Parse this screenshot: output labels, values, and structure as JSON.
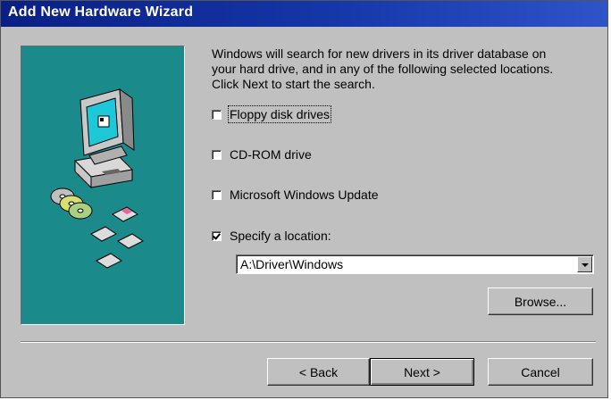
{
  "window": {
    "title": "Add New Hardware Wizard"
  },
  "intro_lines": [
    "Windows will search for new drivers in its driver database on",
    "your hard drive, and in any of the following selected locations.",
    "Click Next to start the search."
  ],
  "options": [
    {
      "label": "Floppy disk drives",
      "checked": false
    },
    {
      "label": "CD-ROM drive",
      "checked": false
    },
    {
      "label": "Microsoft Windows Update",
      "checked": false
    },
    {
      "label": "Specify a location:",
      "checked": true
    }
  ],
  "location": {
    "value": "A:\\Driver\\Windows"
  },
  "buttons": {
    "browse": "Browse...",
    "back": "< Back",
    "next": "Next >",
    "cancel": "Cancel"
  },
  "colors": {
    "titlebar": "#0a1f85",
    "illustration_bg": "#1a8a8a",
    "dialog_bg": "#c0c0c0"
  },
  "illustration": {
    "icons": [
      "computer-icon",
      "cd-discs-icon",
      "floppy-disks-icon"
    ]
  }
}
